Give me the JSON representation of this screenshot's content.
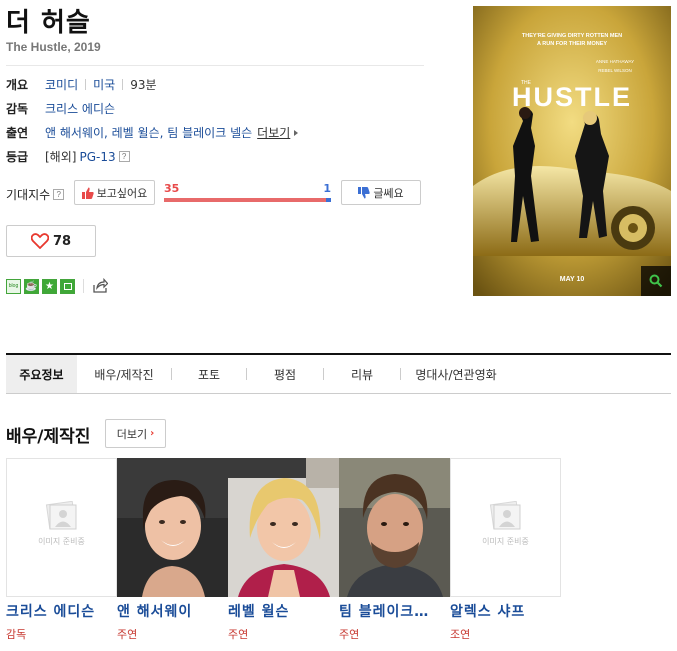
{
  "movie": {
    "title": "더 허슬",
    "subtitle": "The Hustle, 2019"
  },
  "info": {
    "overview_label": "개요",
    "genre": "코미디",
    "country": "미국",
    "runtime": "93분",
    "director_label": "감독",
    "director": "크리스 에디슨",
    "cast_label": "출연",
    "cast_list": "앤 해서웨이, 레벨 윌슨, 팀 블레이크 넬슨",
    "cast_more": "더보기",
    "rating_label": "등급",
    "rating_prefix": "[해외]",
    "rating": "PG-13"
  },
  "expectation": {
    "label": "기대지수",
    "want_label": "보고싶어요",
    "nah_label": "글쎄요",
    "want_count": "35",
    "nah_count": "1",
    "want_fraction": 0.972
  },
  "likes": {
    "count": "78"
  },
  "share": {
    "blog_label": "blog"
  },
  "poster": {
    "tagline_line1": "THEY'RE GIVING DIRTY ROTTEN MEN",
    "tagline_line2": "A RUN FOR THEIR MONEY",
    "actor1": "ANNE HATHAWAY",
    "actor2": "REBEL WILSON",
    "title_small": "THE",
    "title_big": "HUSTLE",
    "date": "MAY 10"
  },
  "tabs": [
    {
      "label": "주요정보"
    },
    {
      "label": "배우/제작진"
    },
    {
      "label": "포토"
    },
    {
      "label": "평점"
    },
    {
      "label": "리뷰"
    },
    {
      "label": "명대사/연관영화"
    }
  ],
  "cast_section": {
    "title": "배우/제작진",
    "more_label": "더보기",
    "placeholder_text": "이미지 준비중",
    "members": [
      {
        "name": "크리스 에디슨",
        "role": "감독"
      },
      {
        "name": "앤 해서웨이",
        "role": "주연"
      },
      {
        "name": "레벨 윌슨",
        "role": "주연"
      },
      {
        "name": "팀 블레이크…",
        "role": "주연"
      },
      {
        "name": "알렉스 샤프",
        "role": "조연"
      }
    ]
  },
  "colors": {
    "link_blue": "#1a4c98",
    "role_red": "#c7372f",
    "want_red": "#e84a4a",
    "nah_blue": "#3b6fd4",
    "poster_gold": "#c9a53a"
  }
}
